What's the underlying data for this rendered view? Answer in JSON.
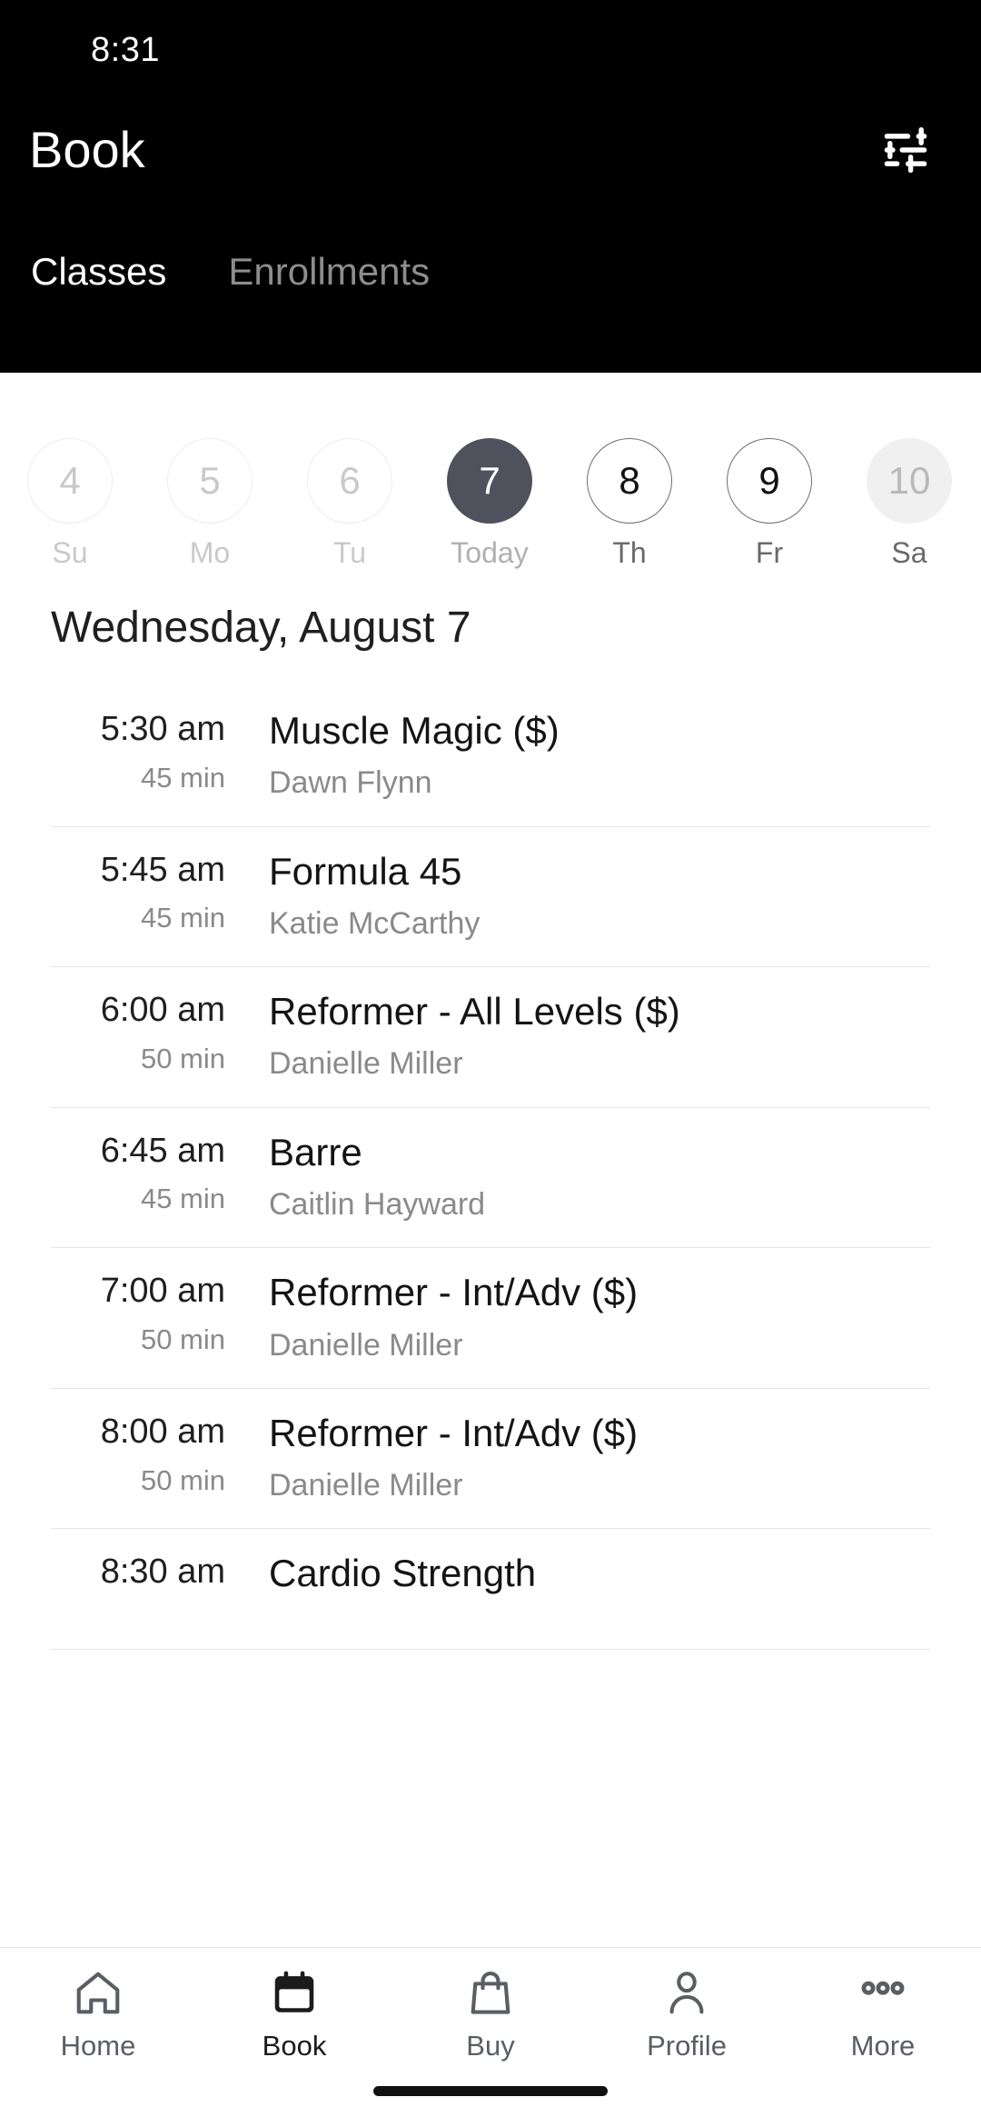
{
  "status_bar": {
    "time": "8:31"
  },
  "header": {
    "title": "Book",
    "filter_icon": "tune-icon",
    "tabs": [
      {
        "label": "Classes",
        "active": true
      },
      {
        "label": "Enrollments",
        "active": false
      }
    ]
  },
  "date_strip": {
    "days": [
      {
        "num": "4",
        "weekday": "Su",
        "state": "past"
      },
      {
        "num": "5",
        "weekday": "Mo",
        "state": "past"
      },
      {
        "num": "6",
        "weekday": "Tu",
        "state": "past"
      },
      {
        "num": "7",
        "weekday": "Today",
        "state": "today"
      },
      {
        "num": "8",
        "weekday": "Th",
        "state": "future"
      },
      {
        "num": "9",
        "weekday": "Fr",
        "state": "future"
      },
      {
        "num": "10",
        "weekday": "Sa",
        "state": "muted"
      }
    ]
  },
  "schedule": {
    "heading": "Wednesday, August 7",
    "classes": [
      {
        "time": "5:30 am",
        "duration": "45 min",
        "name": "Muscle Magic ($)",
        "instructor": "Dawn Flynn"
      },
      {
        "time": "5:45 am",
        "duration": "45 min",
        "name": "Formula 45",
        "instructor": "Katie McCarthy"
      },
      {
        "time": "6:00 am",
        "duration": "50 min",
        "name": "Reformer - All Levels ($)",
        "instructor": "Danielle Miller"
      },
      {
        "time": "6:45 am",
        "duration": "45 min",
        "name": "Barre",
        "instructor": "Caitlin Hayward"
      },
      {
        "time": "7:00 am",
        "duration": "50 min",
        "name": "Reformer - Int/Adv ($)",
        "instructor": "Danielle Miller"
      },
      {
        "time": "8:00 am",
        "duration": "50 min",
        "name": "Reformer - Int/Adv ($)",
        "instructor": "Danielle Miller"
      },
      {
        "time": "8:30 am",
        "duration": "",
        "name": "Cardio Strength",
        "instructor": ""
      }
    ]
  },
  "bottom_nav": {
    "items": [
      {
        "label": "Home",
        "icon": "home-icon",
        "active": false
      },
      {
        "label": "Book",
        "icon": "calendar-icon",
        "active": true
      },
      {
        "label": "Buy",
        "icon": "bag-icon",
        "active": false
      },
      {
        "label": "Profile",
        "icon": "person-icon",
        "active": false
      },
      {
        "label": "More",
        "icon": "ellipsis-icon",
        "active": false
      }
    ]
  },
  "colors": {
    "header_bg": "#000000",
    "today_pill": "#4f525c",
    "muted_pill": "#f0f0f0",
    "secondary_text": "#8a8a8a",
    "divider": "#e6e6e6"
  }
}
